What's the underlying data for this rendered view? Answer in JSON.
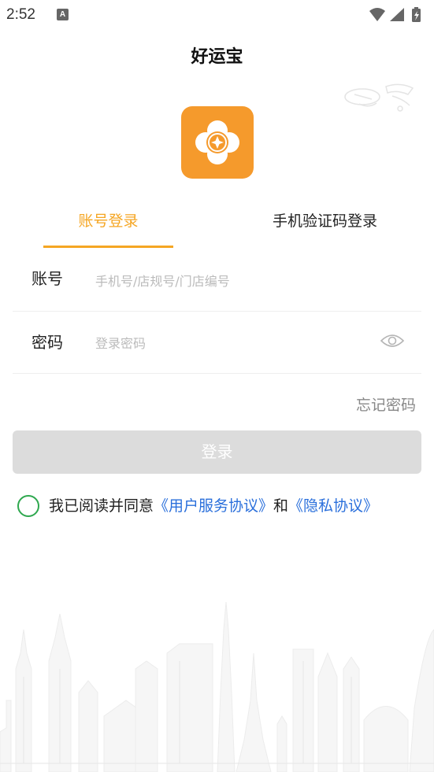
{
  "status_bar": {
    "time": "2:52",
    "notification_glyph": "A",
    "icons": [
      "wifi-icon",
      "signal-icon",
      "battery-charging-icon"
    ]
  },
  "app": {
    "title": "好运宝",
    "logo": "clover-coin-logo",
    "brand_color": "#f59a2c"
  },
  "tabs": {
    "account_login": "账号登录",
    "sms_login": "手机验证码登录",
    "active": "account_login",
    "active_color": "#f5a623"
  },
  "form": {
    "account_label": "账号",
    "account_placeholder": "手机号/店规号/门店编号",
    "account_value": "",
    "password_label": "密码",
    "password_placeholder": "登录密码",
    "password_value": "",
    "password_toggle_icon": "eye-icon"
  },
  "forgot_password": "忘记密码",
  "login_button": "登录",
  "agreement": {
    "prefix": "我已阅读并同意",
    "user_agreement": "《用户服务协议》",
    "conjunction": "和",
    "privacy_policy": "《隐私协议》",
    "checked": false,
    "check_color": "#2fa84f",
    "link_color": "#2a6fdb"
  }
}
